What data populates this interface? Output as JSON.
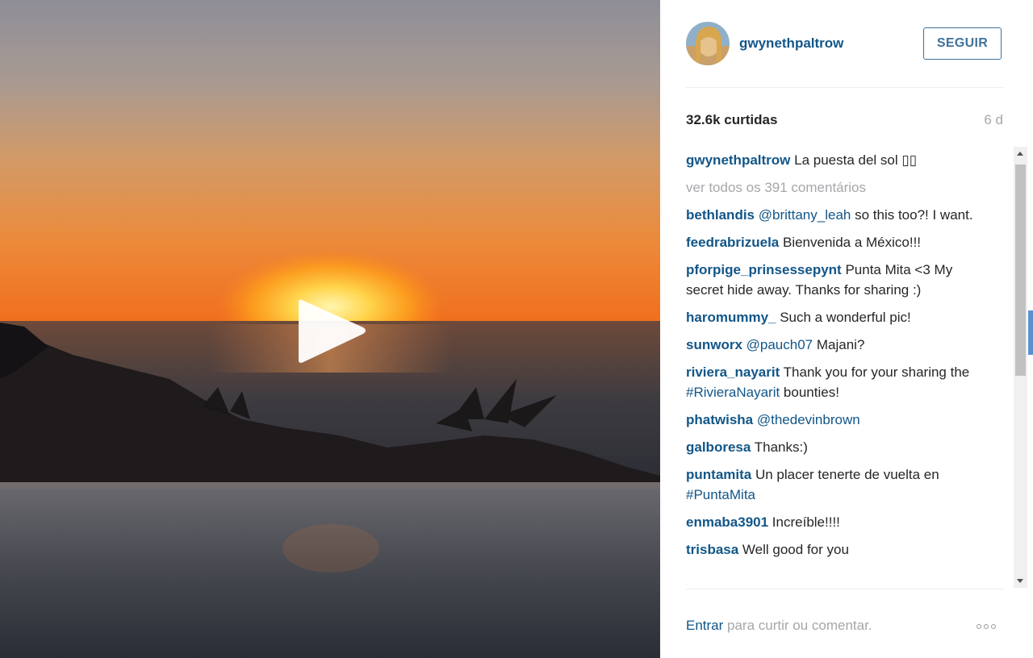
{
  "post": {
    "username": "gwynethpaltrow",
    "follow_label": "SEGUIR",
    "likes": "32.6k curtidas",
    "age": "6 d",
    "caption": {
      "author": "gwynethpaltrow",
      "text": " La puesta del sol ▯▯"
    },
    "view_all": "ver todos os 391 comentários"
  },
  "comments": [
    {
      "author": "bethlandis",
      "parts": [
        {
          "t": " "
        },
        {
          "t": "@brittany_leah",
          "link": true
        },
        {
          "t": " so this too?! I want."
        }
      ]
    },
    {
      "author": "feedrabrizuela",
      "parts": [
        {
          "t": " Bienvenida a México!!!"
        }
      ]
    },
    {
      "author": "pforpige_prinsessepynt",
      "parts": [
        {
          "t": " Punta Mita <3 My secret hide away. Thanks for sharing :)"
        }
      ]
    },
    {
      "author": "haromummy_",
      "parts": [
        {
          "t": " Such a wonderful pic!"
        }
      ]
    },
    {
      "author": "sunworx",
      "parts": [
        {
          "t": " "
        },
        {
          "t": "@pauch07",
          "link": true
        },
        {
          "t": " Majani?"
        }
      ]
    },
    {
      "author": "riviera_nayarit",
      "parts": [
        {
          "t": " Thank you for your sharing the "
        },
        {
          "t": "#RivieraNayarit",
          "link": true
        },
        {
          "t": " bounties!"
        }
      ]
    },
    {
      "author": "phatwisha",
      "parts": [
        {
          "t": " "
        },
        {
          "t": "@thedevinbrown",
          "link": true
        }
      ]
    },
    {
      "author": "galboresa",
      "parts": [
        {
          "t": " Thanks:)"
        }
      ]
    },
    {
      "author": "puntamita",
      "parts": [
        {
          "t": " Un placer tenerte de vuelta en "
        },
        {
          "t": "#PuntaMita",
          "link": true
        }
      ]
    },
    {
      "author": "enmaba3901",
      "parts": [
        {
          "t": " Increíble!!!!"
        }
      ]
    },
    {
      "author": "trisbasa",
      "parts": [
        {
          "t": " Well good for you"
        }
      ]
    }
  ],
  "footer": {
    "login_label": "Entrar",
    "rest": " para curtir ou comentar."
  },
  "colors": {
    "link": "#125688",
    "muted": "#a5a7aa",
    "follow_border": "#3f729b"
  },
  "icons": {
    "play": "play-icon",
    "more": "more-options-icon"
  }
}
